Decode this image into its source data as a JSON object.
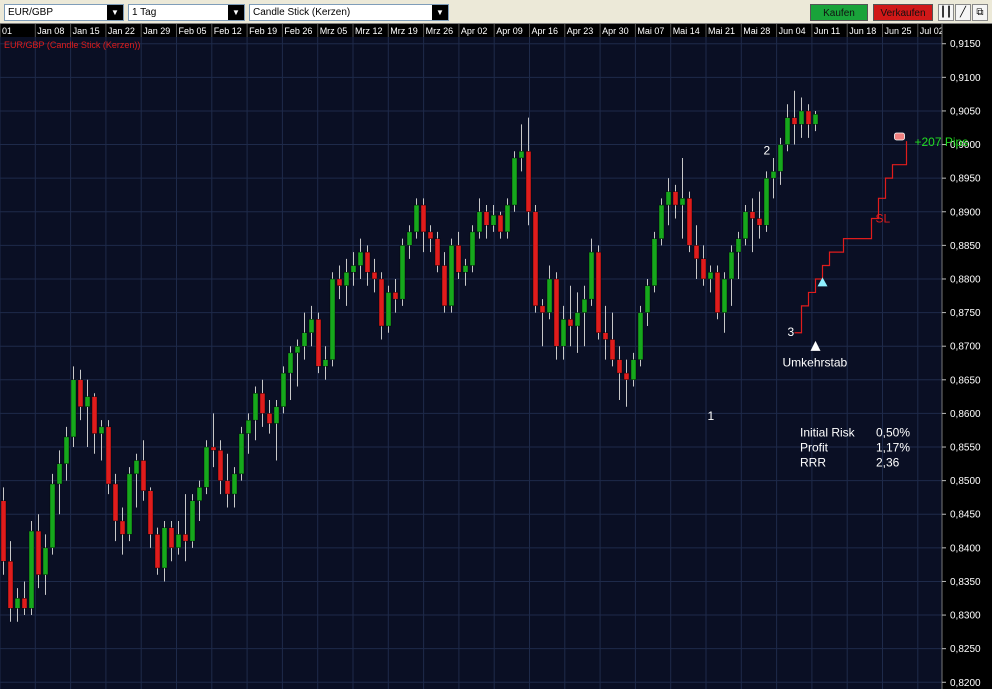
{
  "toolbar": {
    "symbol": "EUR/GBP",
    "timeframe": "1 Tag",
    "chart_style": "Candle Stick (Kerzen)",
    "buy_label": "Kaufen",
    "sell_label": "Verkaufen",
    "buy_color": "#19a33a",
    "sell_color": "#d01818"
  },
  "chart_data": {
    "type": "candlestick",
    "title": "EUR/GBP (Candle Stick (Kerzen))",
    "ylim": [
      0.819,
      0.916
    ],
    "y_ticks": [
      "0,9150",
      "0,9100",
      "0,9050",
      "0,9000",
      "0,8950",
      "0,8900",
      "0,8850",
      "0,8800",
      "0,8750",
      "0,8700",
      "0,8650",
      "0,8600",
      "0,8550",
      "0,8500",
      "0,8450",
      "0,8400",
      "0,8350",
      "0,8300",
      "0,8250",
      "0,8200"
    ],
    "x_ticks": [
      "01",
      "Jan 08",
      "Jan 15",
      "Jan 22",
      "Jan 29",
      "Feb 05",
      "Feb 12",
      "Feb 19",
      "Feb 26",
      "Mrz 05",
      "Mrz 12",
      "Mrz 19",
      "Mrz 26",
      "Apr 02",
      "Apr 09",
      "Apr 16",
      "Apr 23",
      "Apr 30",
      "Mai 07",
      "Mai 14",
      "Mai 21",
      "Mai 28",
      "Jun 04",
      "Jun 11",
      "Jun 18",
      "Jun 25",
      "Jul 02",
      "Ju"
    ],
    "grid": true,
    "bull_color": "#16a81c",
    "bear_color": "#e01c1c",
    "candles": [
      [
        0.847,
        0.849,
        0.836,
        0.838
      ],
      [
        0.838,
        0.841,
        0.829,
        0.831
      ],
      [
        0.831,
        0.834,
        0.829,
        0.8325
      ],
      [
        0.8325,
        0.835,
        0.83,
        0.831
      ],
      [
        0.831,
        0.844,
        0.83,
        0.8425
      ],
      [
        0.8425,
        0.845,
        0.834,
        0.836
      ],
      [
        0.836,
        0.842,
        0.833,
        0.84
      ],
      [
        0.84,
        0.851,
        0.839,
        0.8495
      ],
      [
        0.8495,
        0.8545,
        0.845,
        0.8525
      ],
      [
        0.8525,
        0.858,
        0.85,
        0.8565
      ],
      [
        0.8565,
        0.867,
        0.855,
        0.865
      ],
      [
        0.865,
        0.8665,
        0.859,
        0.861
      ],
      [
        0.861,
        0.865,
        0.855,
        0.8625
      ],
      [
        0.8625,
        0.863,
        0.854,
        0.857
      ],
      [
        0.857,
        0.859,
        0.853,
        0.858
      ],
      [
        0.858,
        0.859,
        0.848,
        0.8495
      ],
      [
        0.8495,
        0.851,
        0.841,
        0.844
      ],
      [
        0.844,
        0.846,
        0.839,
        0.842
      ],
      [
        0.842,
        0.852,
        0.841,
        0.851
      ],
      [
        0.851,
        0.854,
        0.846,
        0.853
      ],
      [
        0.853,
        0.856,
        0.847,
        0.8485
      ],
      [
        0.8485,
        0.849,
        0.84,
        0.842
      ],
      [
        0.842,
        0.843,
        0.836,
        0.837
      ],
      [
        0.837,
        0.844,
        0.835,
        0.843
      ],
      [
        0.843,
        0.844,
        0.838,
        0.84
      ],
      [
        0.84,
        0.844,
        0.839,
        0.842
      ],
      [
        0.842,
        0.848,
        0.838,
        0.841
      ],
      [
        0.841,
        0.848,
        0.84,
        0.847
      ],
      [
        0.847,
        0.85,
        0.844,
        0.849
      ],
      [
        0.849,
        0.856,
        0.848,
        0.855
      ],
      [
        0.855,
        0.86,
        0.852,
        0.8545
      ],
      [
        0.8545,
        0.856,
        0.848,
        0.85
      ],
      [
        0.85,
        0.854,
        0.846,
        0.848
      ],
      [
        0.848,
        0.852,
        0.846,
        0.851
      ],
      [
        0.851,
        0.858,
        0.85,
        0.857
      ],
      [
        0.857,
        0.86,
        0.854,
        0.859
      ],
      [
        0.859,
        0.864,
        0.856,
        0.863
      ],
      [
        0.863,
        0.865,
        0.858,
        0.86
      ],
      [
        0.86,
        0.862,
        0.857,
        0.8585
      ],
      [
        0.8585,
        0.862,
        0.853,
        0.861
      ],
      [
        0.861,
        0.867,
        0.86,
        0.866
      ],
      [
        0.866,
        0.87,
        0.862,
        0.869
      ],
      [
        0.869,
        0.871,
        0.864,
        0.87
      ],
      [
        0.87,
        0.875,
        0.868,
        0.872
      ],
      [
        0.872,
        0.876,
        0.87,
        0.874
      ],
      [
        0.874,
        0.875,
        0.866,
        0.867
      ],
      [
        0.867,
        0.87,
        0.865,
        0.868
      ],
      [
        0.868,
        0.881,
        0.867,
        0.88
      ],
      [
        0.88,
        0.882,
        0.877,
        0.879
      ],
      [
        0.879,
        0.883,
        0.876,
        0.881
      ],
      [
        0.881,
        0.884,
        0.879,
        0.882
      ],
      [
        0.882,
        0.886,
        0.88,
        0.884
      ],
      [
        0.884,
        0.885,
        0.879,
        0.881
      ],
      [
        0.881,
        0.883,
        0.878,
        0.88
      ],
      [
        0.88,
        0.881,
        0.871,
        0.873
      ],
      [
        0.873,
        0.879,
        0.872,
        0.878
      ],
      [
        0.878,
        0.88,
        0.875,
        0.877
      ],
      [
        0.877,
        0.886,
        0.876,
        0.885
      ],
      [
        0.885,
        0.888,
        0.883,
        0.887
      ],
      [
        0.887,
        0.892,
        0.886,
        0.891
      ],
      [
        0.891,
        0.892,
        0.884,
        0.887
      ],
      [
        0.887,
        0.888,
        0.884,
        0.886
      ],
      [
        0.886,
        0.887,
        0.881,
        0.882
      ],
      [
        0.882,
        0.884,
        0.875,
        0.876
      ],
      [
        0.876,
        0.886,
        0.875,
        0.885
      ],
      [
        0.885,
        0.887,
        0.88,
        0.881
      ],
      [
        0.881,
        0.883,
        0.879,
        0.882
      ],
      [
        0.882,
        0.888,
        0.881,
        0.887
      ],
      [
        0.887,
        0.892,
        0.886,
        0.89
      ],
      [
        0.89,
        0.891,
        0.886,
        0.888
      ],
      [
        0.888,
        0.891,
        0.887,
        0.8895
      ],
      [
        0.8895,
        0.89,
        0.886,
        0.887
      ],
      [
        0.887,
        0.892,
        0.886,
        0.891
      ],
      [
        0.891,
        0.899,
        0.89,
        0.898
      ],
      [
        0.898,
        0.903,
        0.896,
        0.899
      ],
      [
        0.899,
        0.904,
        0.888,
        0.89
      ],
      [
        0.89,
        0.891,
        0.875,
        0.876
      ],
      [
        0.876,
        0.877,
        0.87,
        0.875
      ],
      [
        0.875,
        0.882,
        0.874,
        0.88
      ],
      [
        0.88,
        0.881,
        0.868,
        0.87
      ],
      [
        0.87,
        0.876,
        0.868,
        0.874
      ],
      [
        0.874,
        0.879,
        0.87,
        0.873
      ],
      [
        0.873,
        0.878,
        0.869,
        0.875
      ],
      [
        0.875,
        0.879,
        0.87,
        0.877
      ],
      [
        0.877,
        0.886,
        0.876,
        0.884
      ],
      [
        0.884,
        0.885,
        0.871,
        0.872
      ],
      [
        0.872,
        0.876,
        0.868,
        0.871
      ],
      [
        0.871,
        0.875,
        0.867,
        0.868
      ],
      [
        0.868,
        0.87,
        0.862,
        0.866
      ],
      [
        0.866,
        0.868,
        0.861,
        0.865
      ],
      [
        0.865,
        0.869,
        0.864,
        0.868
      ],
      [
        0.868,
        0.876,
        0.867,
        0.875
      ],
      [
        0.875,
        0.88,
        0.873,
        0.879
      ],
      [
        0.879,
        0.887,
        0.878,
        0.886
      ],
      [
        0.886,
        0.892,
        0.885,
        0.891
      ],
      [
        0.891,
        0.895,
        0.888,
        0.893
      ],
      [
        0.893,
        0.894,
        0.889,
        0.891
      ],
      [
        0.891,
        0.898,
        0.886,
        0.892
      ],
      [
        0.892,
        0.893,
        0.884,
        0.885
      ],
      [
        0.885,
        0.888,
        0.88,
        0.883
      ],
      [
        0.883,
        0.885,
        0.879,
        0.88
      ],
      [
        0.88,
        0.882,
        0.878,
        0.881
      ],
      [
        0.881,
        0.882,
        0.874,
        0.875
      ],
      [
        0.875,
        0.881,
        0.872,
        0.88
      ],
      [
        0.88,
        0.885,
        0.876,
        0.884
      ],
      [
        0.884,
        0.887,
        0.88,
        0.886
      ],
      [
        0.886,
        0.891,
        0.885,
        0.89
      ],
      [
        0.89,
        0.892,
        0.884,
        0.889
      ],
      [
        0.889,
        0.893,
        0.886,
        0.888
      ],
      [
        0.888,
        0.896,
        0.887,
        0.895
      ],
      [
        0.895,
        0.898,
        0.892,
        0.896
      ],
      [
        0.896,
        0.901,
        0.894,
        0.9
      ],
      [
        0.9,
        0.906,
        0.899,
        0.904
      ],
      [
        0.904,
        0.908,
        0.9,
        0.903
      ],
      [
        0.903,
        0.907,
        0.901,
        0.905
      ],
      [
        0.905,
        0.906,
        0.901,
        0.903
      ],
      [
        0.903,
        0.905,
        0.902,
        0.9045
      ]
    ],
    "stop_loss_line": {
      "label": "SL",
      "color": "#e01c1c",
      "points": [
        [
          113,
          0.872
        ],
        [
          114,
          0.876
        ],
        [
          115,
          0.878
        ],
        [
          116,
          0.88
        ],
        [
          117,
          0.882
        ],
        [
          118,
          0.884
        ],
        [
          120,
          0.886
        ],
        [
          124,
          0.889
        ],
        [
          125,
          0.892
        ],
        [
          126,
          0.895
        ],
        [
          127,
          0.897
        ],
        [
          129,
          0.9005
        ]
      ]
    },
    "annotations": {
      "wave_1": "1",
      "wave_2": "2",
      "wave_3": "3",
      "reversal_bar": "Umkehrstab",
      "pips": "+207 Pips",
      "pips_color": "#22dd22",
      "stats": [
        {
          "label": "Initial Risk",
          "value": "0,50%"
        },
        {
          "label": "Profit",
          "value": "1,17%"
        },
        {
          "label": "RRR",
          "value": "2,36"
        }
      ]
    }
  }
}
